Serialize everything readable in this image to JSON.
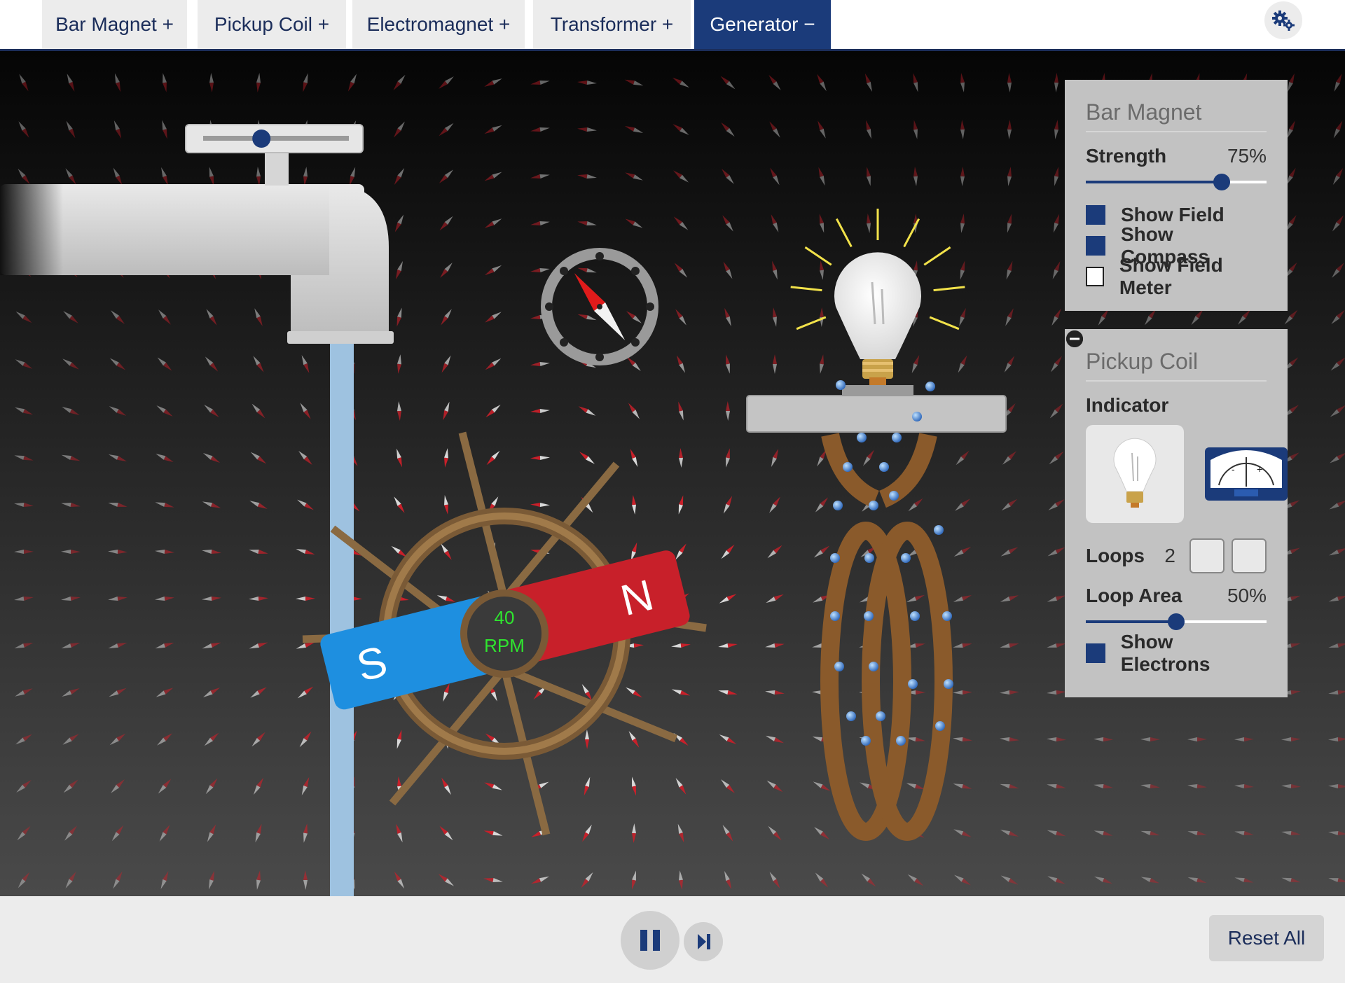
{
  "tabs": [
    {
      "label": "Bar Magnet +",
      "active": false
    },
    {
      "label": "Pickup Coil +",
      "active": false
    },
    {
      "label": "Electromagnet +",
      "active": false
    },
    {
      "label": "Transformer +",
      "active": false
    },
    {
      "label": "Generator −",
      "active": true
    }
  ],
  "settings_icon": "gear-icon",
  "scene": {
    "wheel": {
      "rpm_value": "40",
      "rpm_unit": "RPM"
    },
    "magnet": {
      "south_label": "S",
      "north_label": "N"
    },
    "faucet_flow_fraction": 0.4
  },
  "bar_magnet_panel": {
    "title": "Bar Magnet",
    "strength_label": "Strength",
    "strength_value": "75%",
    "strength_fraction": 0.75,
    "checkboxes": [
      {
        "label": "Show Field",
        "checked": true
      },
      {
        "label": "Show Compass",
        "checked": true
      },
      {
        "label": "Show Field Meter",
        "checked": false
      }
    ]
  },
  "pickup_coil_panel": {
    "title": "Pickup Coil",
    "indicator_label": "Indicator",
    "indicator_options": [
      {
        "icon": "lightbulb-icon",
        "selected": true
      },
      {
        "icon": "voltmeter-icon",
        "selected": false
      }
    ],
    "loops_label": "Loops",
    "loops_value": "2",
    "loop_area_label": "Loop Area",
    "loop_area_value": "50%",
    "loop_area_fraction": 0.5,
    "show_electrons_label": "Show Electrons",
    "show_electrons_checked": true
  },
  "bottom": {
    "pause_icon": "pause-icon",
    "step_icon": "step-forward-icon",
    "reset_label": "Reset All"
  },
  "colors": {
    "accent": "#1b3b7a",
    "magnet_north": "#c8202a",
    "magnet_south": "#1e8fe0",
    "rpm_text": "#2fe62f",
    "coil": "#8a5a2b",
    "bulb_rays": "#f2e24a"
  }
}
